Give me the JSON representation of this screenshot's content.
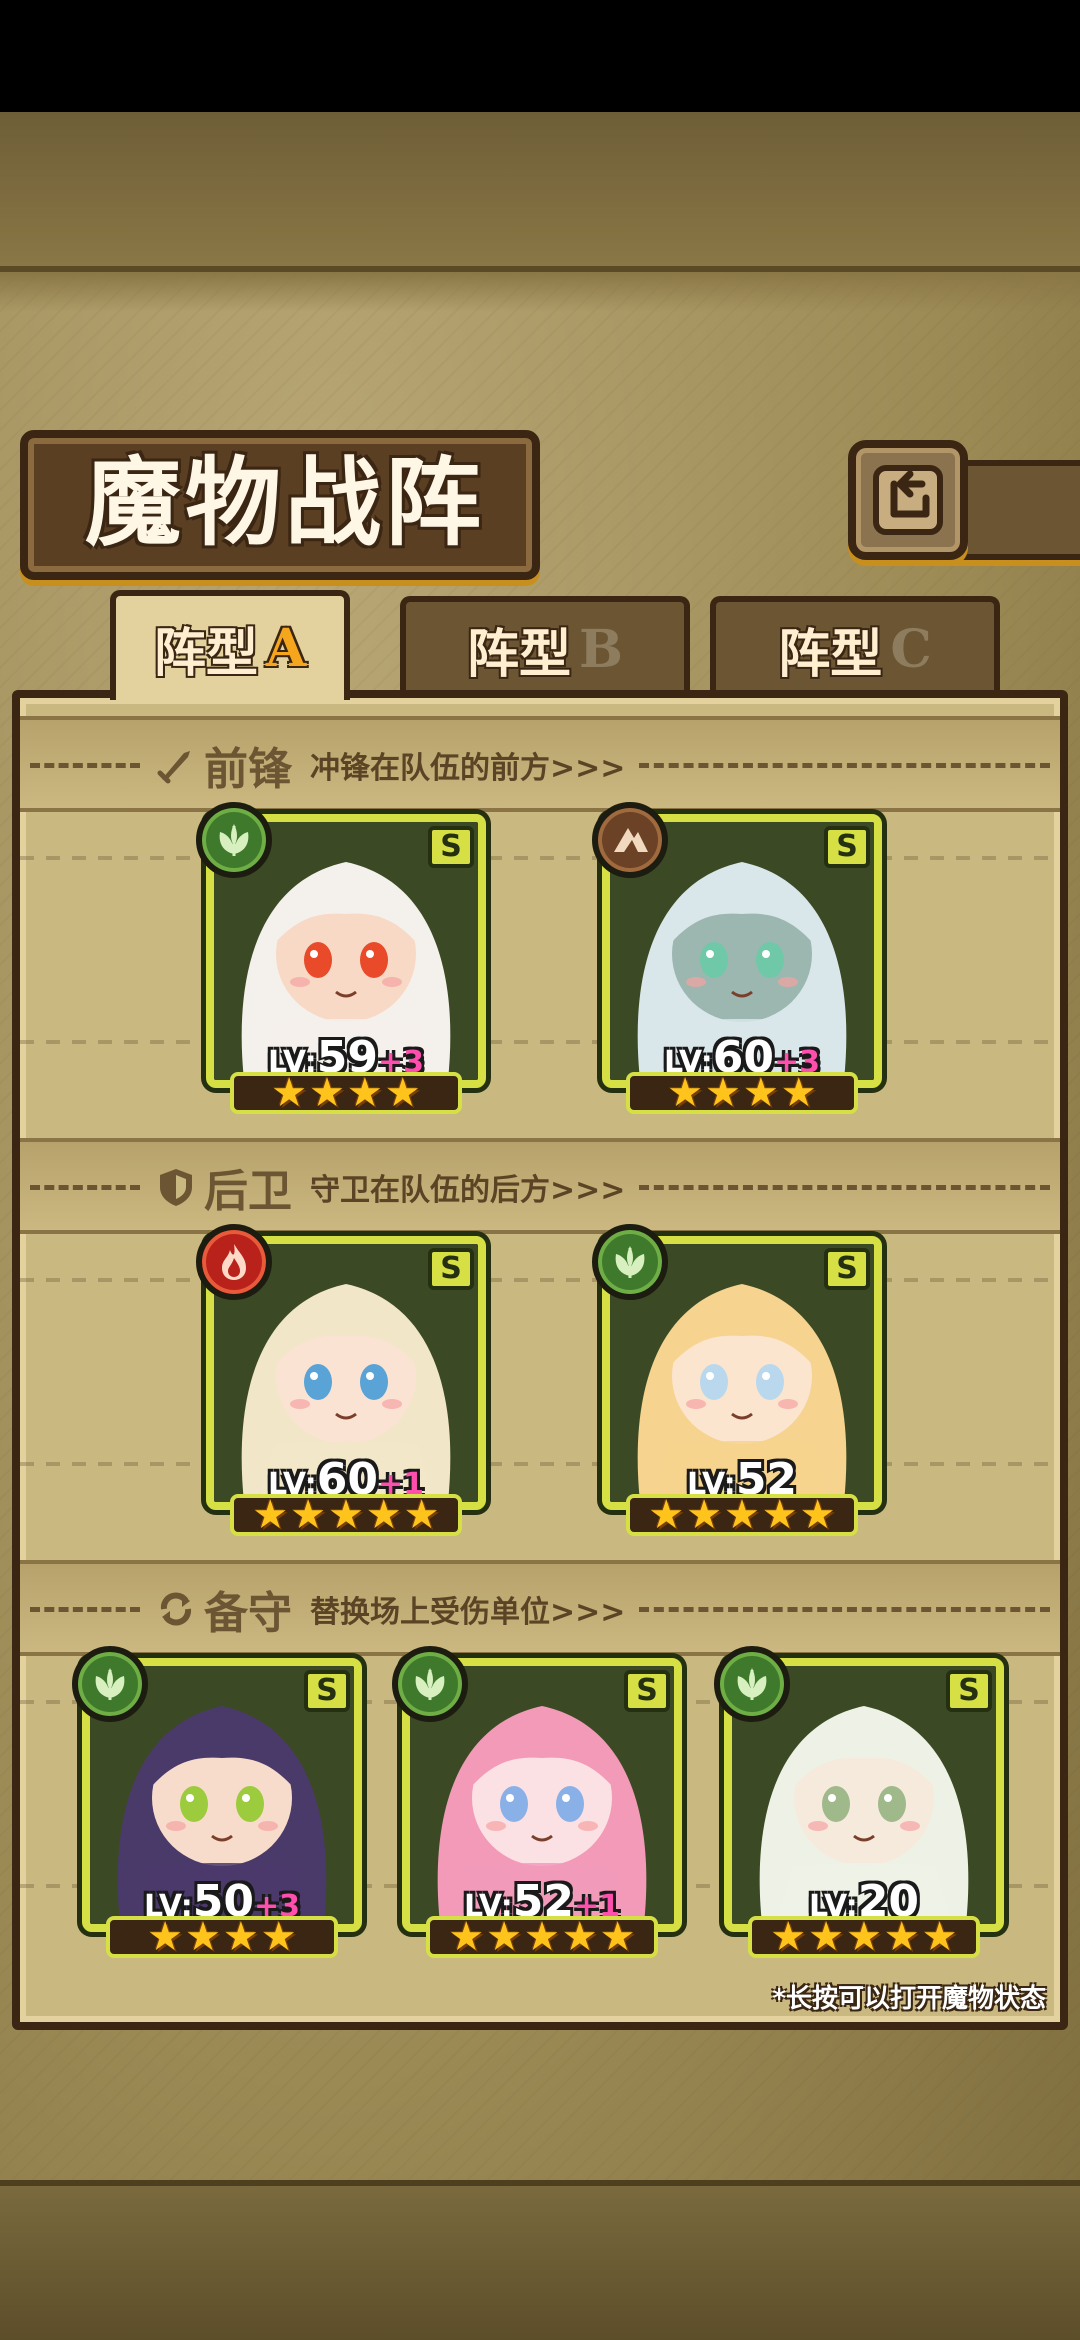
{
  "title": "魔物战阵",
  "tabs": [
    {
      "prefix": "阵型",
      "letter": "A",
      "active": true
    },
    {
      "prefix": "阵型",
      "letter": "B",
      "active": false
    },
    {
      "prefix": "阵型",
      "letter": "C",
      "active": false
    }
  ],
  "sections": {
    "vanguard": {
      "title": "前锋",
      "desc": "冲锋在队伍的前方>>>",
      "icon": "sword-icon"
    },
    "rearguard": {
      "title": "后卫",
      "desc": "守卫在队伍的后方>>>",
      "icon": "shield-icon"
    },
    "reserve": {
      "title": "备守",
      "desc": "替换场上受伤单位>>>",
      "icon": "swap-icon"
    }
  },
  "cards": {
    "vanguard": [
      {
        "element": "leaf",
        "rank": "S",
        "lv_prefix": "LV:",
        "lv": "59",
        "plus": "+3",
        "stars": 4
      },
      {
        "element": "earth",
        "rank": "S",
        "lv_prefix": "LV:",
        "lv": "60",
        "plus": "+3",
        "stars": 4
      }
    ],
    "rearguard": [
      {
        "element": "fire",
        "rank": "S",
        "lv_prefix": "LV:",
        "lv": "60",
        "plus": "+1",
        "stars": 5
      },
      {
        "element": "leaf",
        "rank": "S",
        "lv_prefix": "LV:",
        "lv": "52",
        "plus": "",
        "stars": 5
      }
    ],
    "reserve": [
      {
        "element": "leaf",
        "rank": "S",
        "lv_prefix": "LV:",
        "lv": "50",
        "plus": "+3",
        "stars": 4
      },
      {
        "element": "leaf",
        "rank": "S",
        "lv_prefix": "LV:",
        "lv": "52",
        "plus": "+1",
        "stars": 5
      },
      {
        "element": "leaf",
        "rank": "S",
        "lv_prefix": "LV:",
        "lv": "20",
        "plus": "",
        "stars": 5
      }
    ]
  },
  "footer_note": "*长按可以打开魔物状态",
  "colors": {
    "accent": "#f5a61c",
    "frame": "#d6e044",
    "wood": "#3a2613",
    "plus": "#ff4fae"
  }
}
